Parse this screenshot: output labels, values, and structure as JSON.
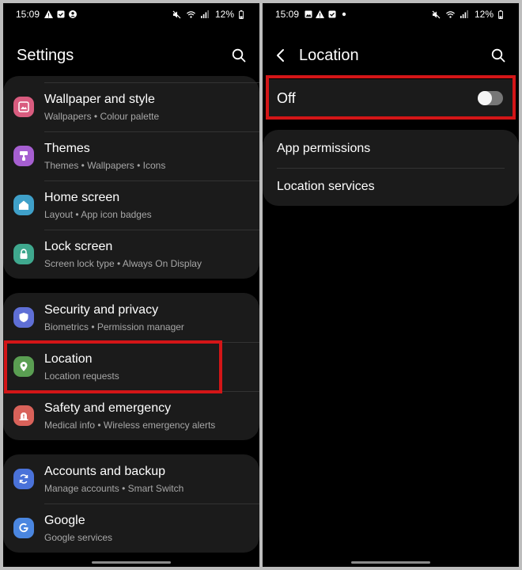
{
  "left": {
    "status": {
      "time": "15:09",
      "battery": "12%"
    },
    "title": "Settings",
    "groups": [
      {
        "items": [
          {
            "label": "Wallpaper and style",
            "sub": "Wallpapers  •  Colour palette",
            "color": "#d95c7f"
          },
          {
            "label": "Themes",
            "sub": "Themes  •  Wallpapers  •  Icons",
            "color": "#a65fd1"
          },
          {
            "label": "Home screen",
            "sub": "Layout  •  App icon badges",
            "color": "#3fa0c9"
          },
          {
            "label": "Lock screen",
            "sub": "Screen lock type  •  Always On Display",
            "color": "#3fa88e"
          }
        ]
      },
      {
        "items": [
          {
            "label": "Security and privacy",
            "sub": "Biometrics  •  Permission manager",
            "color": "#5f6fd6"
          },
          {
            "label": "Location",
            "sub": "Location requests",
            "color": "#5a9e52"
          },
          {
            "label": "Safety and emergency",
            "sub": "Medical info  •  Wireless emergency alerts",
            "color": "#d9625a"
          }
        ]
      },
      {
        "items": [
          {
            "label": "Accounts and backup",
            "sub": "Manage accounts  •  Smart Switch",
            "color": "#4a72d9"
          },
          {
            "label": "Google",
            "sub": "Google services",
            "color": "#4a86e0"
          }
        ]
      }
    ]
  },
  "right": {
    "status": {
      "time": "15:09",
      "battery": "12%"
    },
    "title": "Location",
    "master_switch": {
      "label": "Off",
      "on": false
    },
    "items": [
      {
        "label": "App permissions"
      },
      {
        "label": "Location services"
      }
    ]
  },
  "highlight_color": "#d31517"
}
